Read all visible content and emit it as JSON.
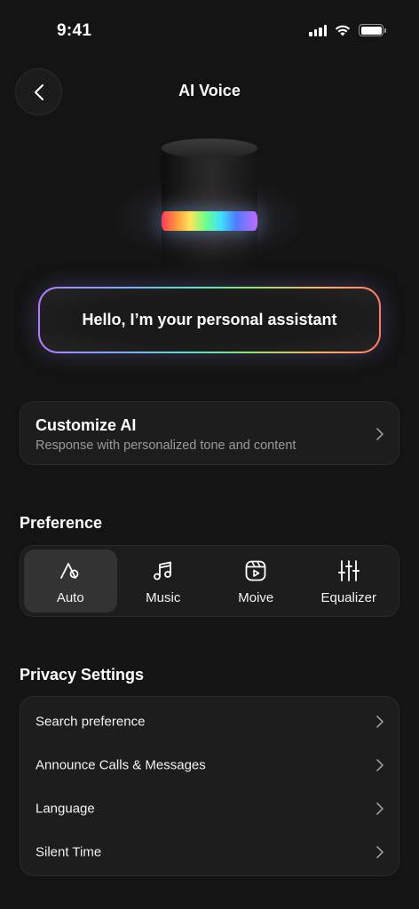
{
  "status_bar": {
    "time": "9:41"
  },
  "header": {
    "title": "AI Voice"
  },
  "greeting": {
    "text": "Hello, I’m your personal assistant"
  },
  "customize": {
    "title": "Customize AI",
    "subtitle": "Response with personalized tone and content"
  },
  "preference": {
    "title": "Preference",
    "selected": "Auto",
    "options": [
      {
        "label": "Auto",
        "icon": "auto-icon"
      },
      {
        "label": "Music",
        "icon": "music-note-icon"
      },
      {
        "label": "Moive",
        "icon": "video-play-icon"
      },
      {
        "label": "Equalizer",
        "icon": "equalizer-icon"
      }
    ]
  },
  "privacy": {
    "title": "Privacy Settings",
    "items": [
      {
        "label": "Search preference"
      },
      {
        "label": "Announce Calls & Messages"
      },
      {
        "label": "Language"
      },
      {
        "label": "Silent Time"
      }
    ]
  },
  "colors": {
    "background": "#141414",
    "card": "#1d1d1d",
    "active_segment": "#333333",
    "secondary_text": "#9a9a9a"
  }
}
